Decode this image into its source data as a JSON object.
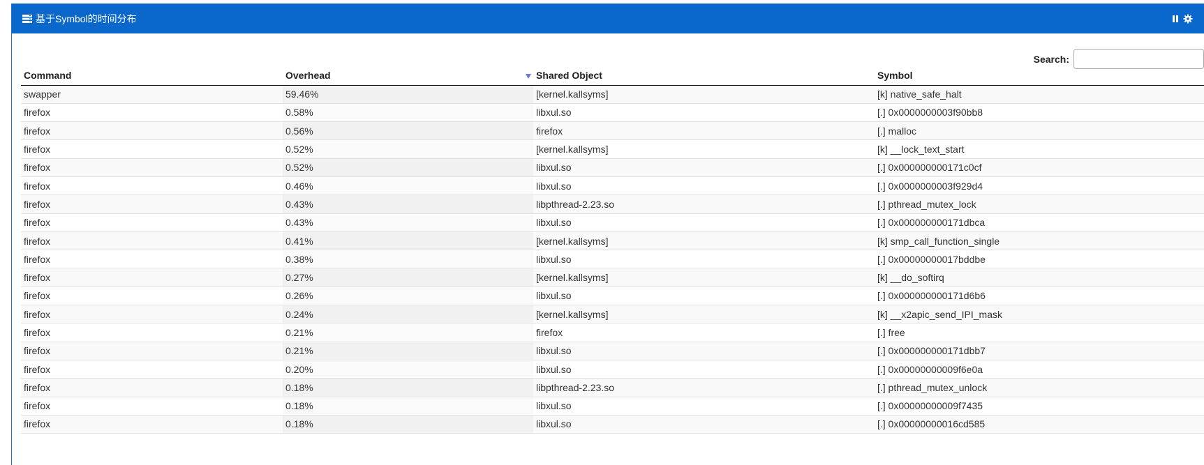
{
  "panel": {
    "title": "基于Symbol的时间分布",
    "header_color": "#0a67cc"
  },
  "search": {
    "label": "Search:",
    "value": "",
    "placeholder": ""
  },
  "table": {
    "columns": [
      "Command",
      "Overhead",
      "Shared Object",
      "Symbol"
    ],
    "sorted_column": "Overhead",
    "sort_direction": "descending",
    "rows": [
      [
        "swapper",
        "59.46%",
        "[kernel.kallsyms]",
        "[k] native_safe_halt"
      ],
      [
        "firefox",
        "0.58%",
        "libxul.so",
        "[.] 0x0000000003f90bb8"
      ],
      [
        "firefox",
        "0.56%",
        "firefox",
        "[.] malloc"
      ],
      [
        "firefox",
        "0.52%",
        "[kernel.kallsyms]",
        "[k] __lock_text_start"
      ],
      [
        "firefox",
        "0.52%",
        "libxul.so",
        "[.] 0x000000000171c0cf"
      ],
      [
        "firefox",
        "0.46%",
        "libxul.so",
        "[.] 0x0000000003f929d4"
      ],
      [
        "firefox",
        "0.43%",
        "libpthread-2.23.so",
        "[.] pthread_mutex_lock"
      ],
      [
        "firefox",
        "0.43%",
        "libxul.so",
        "[.] 0x000000000171dbca"
      ],
      [
        "firefox",
        "0.41%",
        "[kernel.kallsyms]",
        "[k] smp_call_function_single"
      ],
      [
        "firefox",
        "0.38%",
        "libxul.so",
        "[.] 0x00000000017bddbe"
      ],
      [
        "firefox",
        "0.27%",
        "[kernel.kallsyms]",
        "[k] __do_softirq"
      ],
      [
        "firefox",
        "0.26%",
        "libxul.so",
        "[.] 0x000000000171d6b6"
      ],
      [
        "firefox",
        "0.24%",
        "[kernel.kallsyms]",
        "[k] __x2apic_send_IPI_mask"
      ],
      [
        "firefox",
        "0.21%",
        "firefox",
        "[.] free"
      ],
      [
        "firefox",
        "0.21%",
        "libxul.so",
        "[.] 0x000000000171dbb7"
      ],
      [
        "firefox",
        "0.20%",
        "libxul.so",
        "[.] 0x00000000009f6e0a"
      ],
      [
        "firefox",
        "0.18%",
        "libpthread-2.23.so",
        "[.] pthread_mutex_unlock"
      ],
      [
        "firefox",
        "0.18%",
        "libxul.so",
        "[.] 0x00000000009f7435"
      ],
      [
        "firefox",
        "0.18%",
        "libxul.so",
        "[.] 0x00000000016cd585"
      ]
    ]
  },
  "icons": {
    "title": "server-icon",
    "controls": [
      "pause-icon",
      "gear-icon"
    ]
  }
}
